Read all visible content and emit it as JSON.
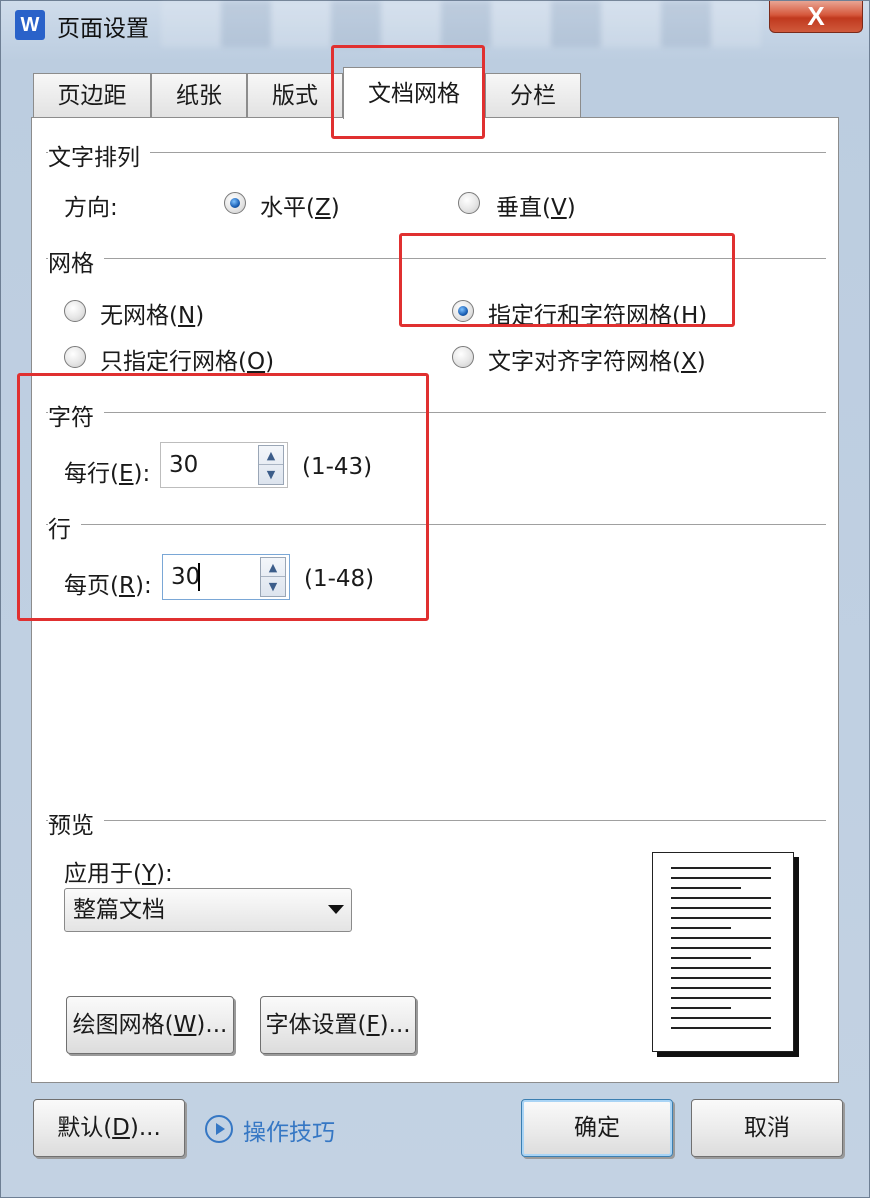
{
  "window": {
    "title": "页面设置",
    "app_icon_letter": "W",
    "close_label": "X"
  },
  "tabs": [
    {
      "label": "页边距",
      "active": false
    },
    {
      "label": "纸张",
      "active": false
    },
    {
      "label": "版式",
      "active": false
    },
    {
      "label": "文档网格",
      "active": true
    },
    {
      "label": "分栏",
      "active": false
    }
  ],
  "text_arrangement": {
    "title": "文字排列",
    "direction_label": "方向:",
    "options": [
      {
        "label": "水平(",
        "accel": "Z",
        "suffix": ")",
        "checked": true
      },
      {
        "label": "垂直(",
        "accel": "V",
        "suffix": ")",
        "checked": false
      }
    ]
  },
  "grid": {
    "title": "网格",
    "options": [
      {
        "label": "无网格(",
        "accel": "N",
        "suffix": ")",
        "checked": false
      },
      {
        "label": "指定行和字符网格(",
        "accel": "H",
        "suffix": ")",
        "checked": true
      },
      {
        "label": "只指定行网格(",
        "accel": "O",
        "suffix": ")",
        "checked": false
      },
      {
        "label": "文字对齐字符网格(",
        "accel": "X",
        "suffix": ")",
        "checked": false
      }
    ]
  },
  "characters": {
    "title": "字符",
    "per_line_label": "每行(",
    "per_line_accel": "E",
    "per_line_suffix": "):",
    "per_line_value": "30",
    "range": "(1-43)"
  },
  "lines": {
    "title": "行",
    "per_page_label": "每页(",
    "per_page_accel": "R",
    "per_page_suffix": "):",
    "per_page_value": "30",
    "range": "(1-48)"
  },
  "preview": {
    "title": "预览",
    "apply_to_label": "应用于(",
    "apply_to_accel": "Y",
    "apply_to_suffix": "):",
    "apply_to_value": "整篇文档"
  },
  "buttons": {
    "drawing_grid": {
      "label": "绘图网格(",
      "accel": "W",
      "suffix": ")..."
    },
    "font_settings": {
      "label": "字体设置(",
      "accel": "F",
      "suffix": ")..."
    },
    "default": {
      "label": "默认(",
      "accel": "D",
      "suffix": ")..."
    },
    "tips": "操作技巧",
    "ok": "确定",
    "cancel": "取消"
  },
  "colors": {
    "highlight_box": "#e03030",
    "link": "#3577c4",
    "radio_checked": "#1a5fb4"
  }
}
